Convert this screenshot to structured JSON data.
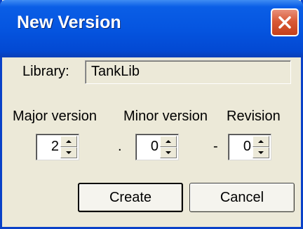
{
  "window": {
    "title": "New Version"
  },
  "library": {
    "label": "Library:",
    "value": "TankLib"
  },
  "versions": [
    {
      "label": "Major version",
      "value": "2"
    },
    {
      "label": "Minor version",
      "value": "0"
    },
    {
      "label": "Revision",
      "value": "0"
    }
  ],
  "separators": {
    "dot": ".",
    "dash": "-"
  },
  "buttons": {
    "create": "Create",
    "cancel": "Cancel"
  },
  "icons": {
    "close": "close-icon",
    "up": "spin-up-icon",
    "down": "spin-down-icon"
  },
  "colors": {
    "titlebar": "#0555e0",
    "close": "#d95a36",
    "dialog": "#ece9d8"
  }
}
